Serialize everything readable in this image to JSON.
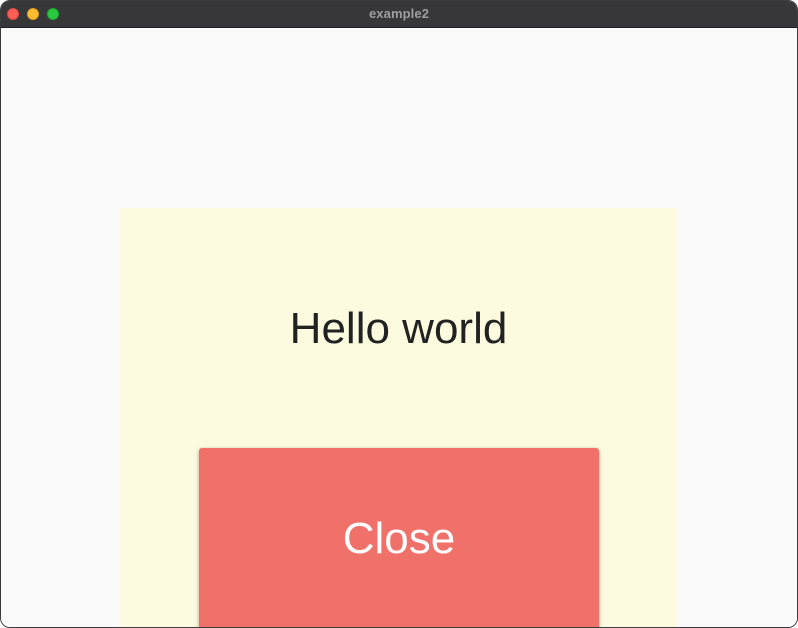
{
  "window": {
    "title": "example2"
  },
  "main": {
    "greeting": "Hello world",
    "close_label": "Close"
  },
  "colors": {
    "panel_background": "#fdfbdf",
    "close_button": "#f0716a",
    "window_background": "#fafafa"
  }
}
